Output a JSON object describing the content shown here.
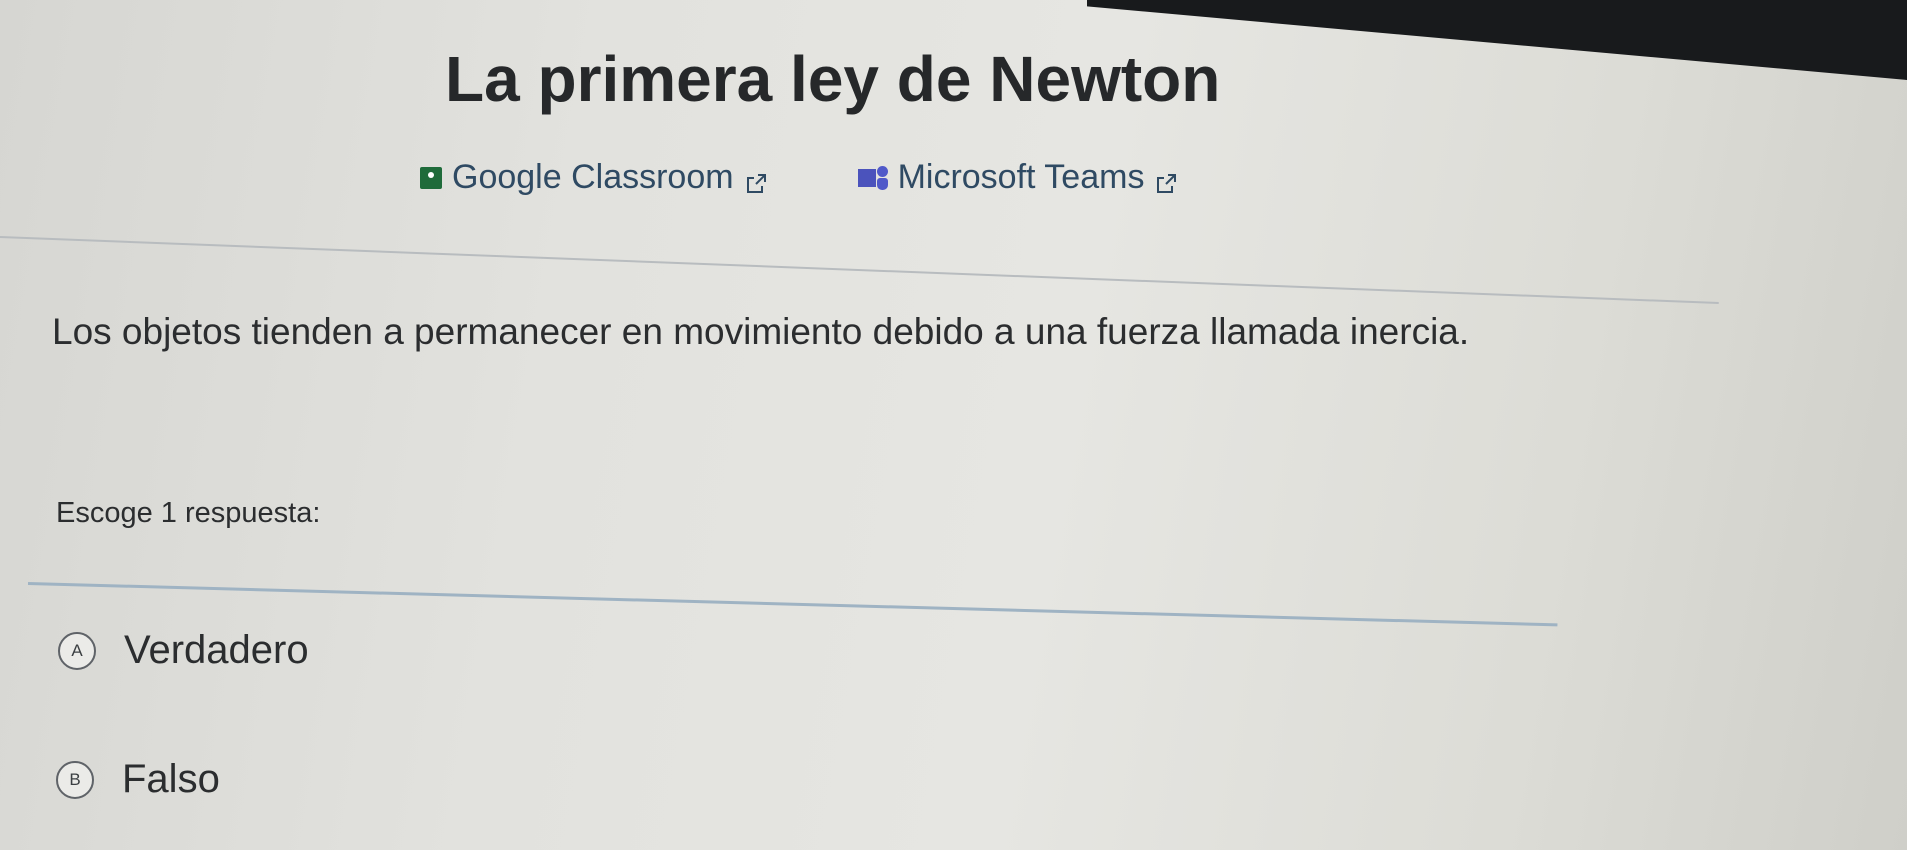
{
  "page": {
    "title": "La primera ley de Newton"
  },
  "integrations": {
    "google_classroom": {
      "label": "Google Classroom",
      "icon": "google-classroom-icon",
      "color": "#1f6b3a"
    },
    "microsoft_teams": {
      "label": "Microsoft Teams",
      "icon": "microsoft-teams-icon",
      "color": "#4b53bc"
    },
    "external_link_icon": "external-link-icon"
  },
  "question": {
    "text": "Los objetos tienden a permanecer en movimiento debido a una fuerza llamada inercia.",
    "instruction": "Escoge 1 respuesta:"
  },
  "choices": [
    {
      "letter": "A",
      "label": "Verdadero"
    },
    {
      "letter": "B",
      "label": "Falso"
    }
  ]
}
